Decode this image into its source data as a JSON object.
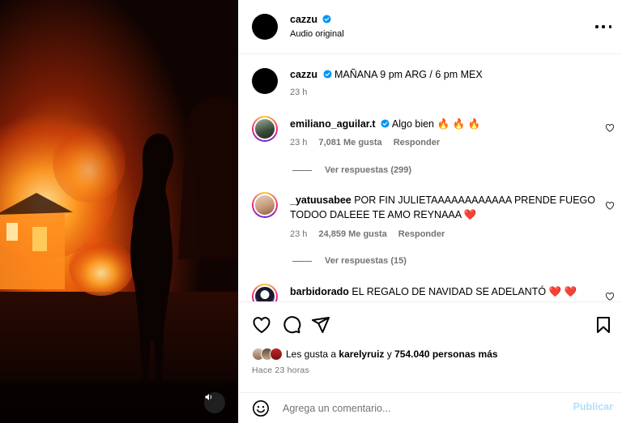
{
  "header": {
    "username": "cazzu",
    "subtitle": "Audio original",
    "more_icon": "more-horizontal-icon"
  },
  "caption": {
    "username": "cazzu",
    "text": "MAÑANA 9 pm ARG / 6 pm MEX",
    "time": "23 h"
  },
  "comments": [
    {
      "username": "emiliano_aguilar.t",
      "verified": true,
      "lines": [
        "Algo bien 🔥 🔥 🔥"
      ],
      "time": "23 h",
      "likes": "7,081 Me gusta",
      "reply": "Responder",
      "view_replies": "Ver respuestas (299)"
    },
    {
      "username": "_yatuusabee",
      "verified": false,
      "lines": [
        "POR FIN JULIETAAAAAAAAAAAA PRENDE FUEGO",
        "TODOO DALEEE TE AMO REYNAAA ❤️"
      ],
      "time": "23 h",
      "likes": "24,859 Me gusta",
      "reply": "Responder",
      "view_replies": "Ver respuestas (15)"
    },
    {
      "username": "barbidorado",
      "verified": false,
      "lines": [
        "EL REGALO DE NAVIDAD SE ADELANTÓ ❤️ ❤️"
      ]
    }
  ],
  "likes": {
    "prefix": "Les gusta a",
    "user": "karelyruiz",
    "conj": "y",
    "count": "754.040 personas más"
  },
  "time_ago": "Hace 23 horas",
  "comment_input": {
    "placeholder": "Agrega un comentario...",
    "publish_label": "Publicar"
  },
  "colors": {
    "verified": "#0095f6",
    "muted": "#737373",
    "publish_disabled": "#b2dffc",
    "heart_red": "#ed4956",
    "fire_orange": "#f56a00"
  }
}
